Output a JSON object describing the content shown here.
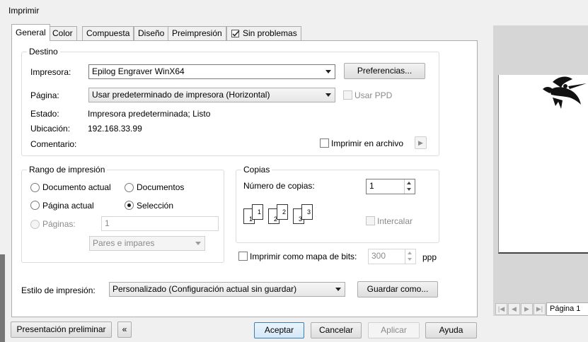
{
  "window": {
    "title": "Imprimir"
  },
  "tabs": [
    {
      "label": "General"
    },
    {
      "label": "Color"
    },
    {
      "label": "Compuesta"
    },
    {
      "label": "Diseño"
    },
    {
      "label": "Preimpresión"
    },
    {
      "label": "Sin problemas"
    }
  ],
  "destino": {
    "group_label": "Destino",
    "impresora_label": "Impresora:",
    "impresora_value": "Epilog Engraver WinX64",
    "preferencias_label": "Preferencias...",
    "pagina_label": "Página:",
    "pagina_value": "Usar predeterminado de impresora (Horizontal)",
    "usar_ppd_label": "Usar PPD",
    "estado_label": "Estado:",
    "estado_value": "Impresora predeterminada; Listo",
    "ubicacion_label": "Ubicación:",
    "ubicacion_value": "192.168.33.99",
    "comentario_label": "Comentario:",
    "imprimir_archivo_label": "Imprimir en archivo"
  },
  "rango": {
    "group_label": "Rango de impresión",
    "documento_actual": "Documento actual",
    "documentos": "Documentos",
    "pagina_actual": "Página actual",
    "seleccion": "Selección",
    "paginas": "Páginas:",
    "paginas_value": "1",
    "pares_impares": "Pares e impares"
  },
  "copias": {
    "group_label": "Copias",
    "numero_label": "Número de copias:",
    "numero_value": "1",
    "intercalar_label": "Intercalar",
    "icon_numbers": [
      "1",
      "1",
      "2",
      "2",
      "3",
      "3"
    ]
  },
  "bitmap": {
    "label": "Imprimir como mapa de bits:",
    "value": "300",
    "unit": "ppp"
  },
  "estilo": {
    "label": "Estilo de impresión:",
    "value": "Personalizado (Configuración actual sin guardar)",
    "guardar_label": "Guardar como..."
  },
  "footer": {
    "presentacion_label": "Presentación preliminar",
    "aceptar_label": "Aceptar",
    "cancelar_label": "Cancelar",
    "aplicar_label": "Aplicar",
    "ayuda_label": "Ayuda"
  },
  "preview": {
    "page_tab": "Página 1"
  },
  "colors": {
    "panel_bg": "#ffffff",
    "window_bg": "#f0f0f0",
    "preview_bg": "#d6d6d6",
    "accent_border": "#3c7fb1"
  }
}
